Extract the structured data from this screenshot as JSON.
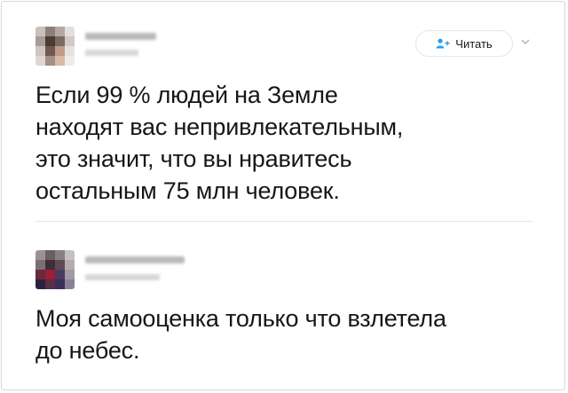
{
  "tweets": [
    {
      "follow_label": "Читать",
      "text_lines": [
        "Если 99 % людей на Земле",
        "находят вас непривлекательным,",
        "это значит, что вы нравитесь",
        "остальным 75 млн человек."
      ]
    },
    {
      "text_lines": [
        "Моя самооценка только что взлетела",
        "до небес."
      ]
    }
  ],
  "colors": {
    "accent": "#1da1f2",
    "text": "#14171a",
    "divider": "#e1e8ed"
  },
  "icons": [
    "follow-user-icon",
    "chevron-down-icon"
  ]
}
